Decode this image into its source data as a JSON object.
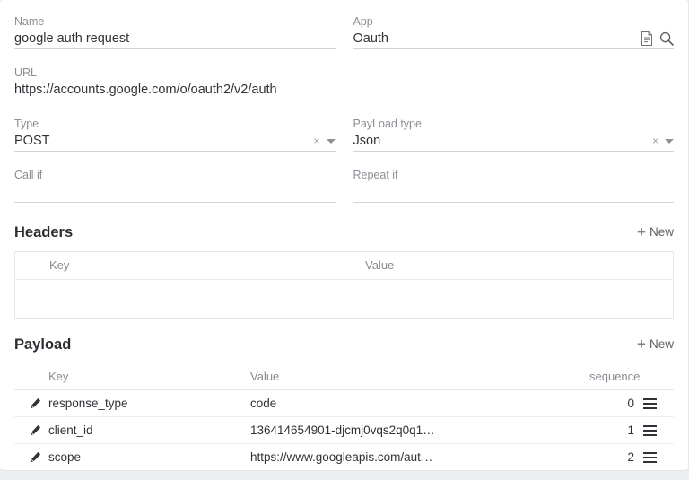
{
  "form": {
    "name": {
      "label": "Name",
      "value": "google auth request"
    },
    "app": {
      "label": "App",
      "value": "Oauth",
      "doc_icon": "document-icon",
      "search_icon": "search-icon"
    },
    "url": {
      "label": "URL",
      "value": "https://accounts.google.com/o/oauth2/v2/auth"
    },
    "type": {
      "label": "Type",
      "value": "POST",
      "clear": "×"
    },
    "payload_type": {
      "label": "PayLoad type",
      "value": "Json",
      "clear": "×"
    },
    "call_if": {
      "label": "Call if",
      "value": ""
    },
    "repeat_if": {
      "label": "Repeat if",
      "value": ""
    }
  },
  "headers": {
    "title": "Headers",
    "new_label": "New",
    "plus": "+",
    "columns": {
      "key": "Key",
      "value": "Value"
    },
    "rows": []
  },
  "payload": {
    "title": "Payload",
    "new_label": "New",
    "plus": "+",
    "columns": {
      "key": "Key",
      "value": "Value",
      "sequence": "sequence"
    },
    "rows": [
      {
        "key": "response_type",
        "value": "code",
        "sequence": "0"
      },
      {
        "key": "client_id",
        "value": "136414654901-djcmj0vqs2q0q1…",
        "sequence": "1"
      },
      {
        "key": "scope",
        "value": "https://www.googleapis.com/aut…",
        "sequence": "2"
      }
    ]
  },
  "colors": {
    "label": "#8a8f94",
    "value": "#2f3337",
    "underline": "#cfd4d8",
    "background": "#eceff1",
    "card": "#ffffff"
  }
}
